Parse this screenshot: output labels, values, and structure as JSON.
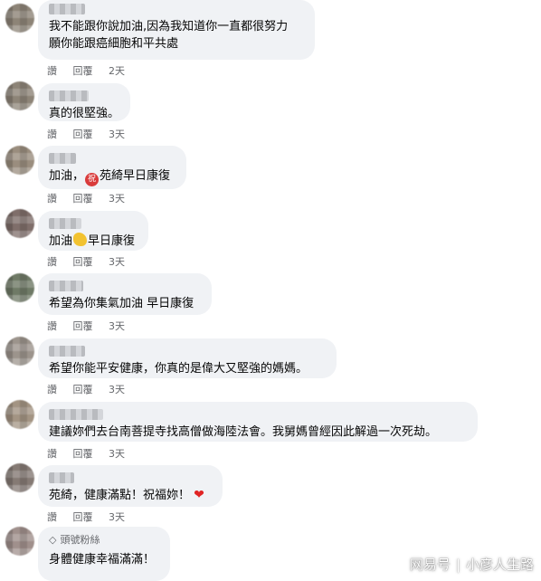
{
  "comments": [
    {
      "text": "我不能跟你說加油,因為我知道你一直都很努力",
      "text2": "願你能跟癌細胞和平共處",
      "like": "讚",
      "reply": "回覆",
      "time": "2天"
    },
    {
      "text": "真的很堅強。",
      "like": "讚",
      "reply": "回覆",
      "time": "3天"
    },
    {
      "text_before": "加油，",
      "emoji": "祝",
      "text_after": "苑綺早日康復",
      "like": "讚",
      "reply": "回覆",
      "time": "3天"
    },
    {
      "text_before": "加油",
      "text_after": "早日康復",
      "like": "讚",
      "reply": "回覆",
      "time": "3天"
    },
    {
      "text": "希望為你集氣加油 早日康復",
      "like": "讚",
      "reply": "回覆",
      "time": "3天"
    },
    {
      "text": "希望你能平安健康，你真的是偉大又堅強的媽媽。",
      "like": "讚",
      "reply": "回覆",
      "time": "3天"
    },
    {
      "text": "建議妳們去台南菩提寺找高僧做海陸法會。我舅媽曾經因此解過一次死劫。",
      "like": "讚",
      "reply": "回覆",
      "time": "3天"
    },
    {
      "text": "苑綺，健康滿點！祝福妳！",
      "heart": "❤",
      "like": "讚",
      "reply": "回覆",
      "time": "3天"
    },
    {
      "badge": "頭號粉絲",
      "text": "身體健康幸福滿滿！"
    }
  ],
  "watermark": {
    "left": "网易号",
    "sep": "|",
    "right": "小彦人生路"
  }
}
